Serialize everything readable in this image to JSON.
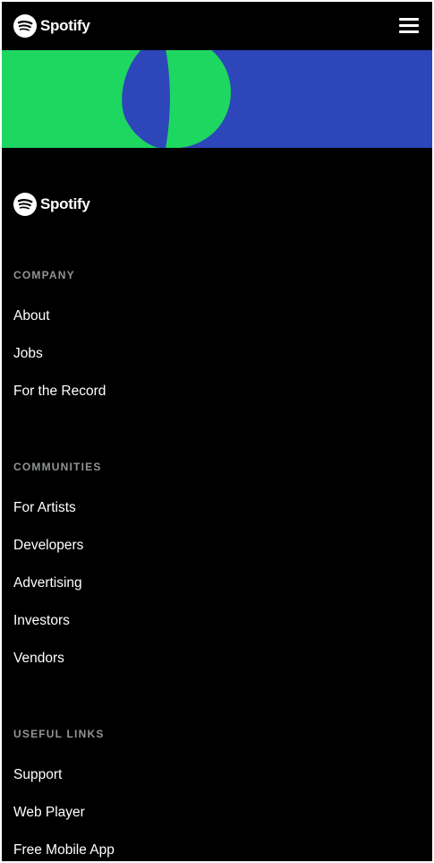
{
  "header": {
    "logo_text": "Spotify",
    "logo_icon": "spotify-logo-icon",
    "menu_icon": "hamburger-menu-icon"
  },
  "banner": {
    "colors": {
      "green": "#1ed760",
      "blue": "#2d46b9"
    }
  },
  "footer": {
    "logo_text": "Spotify",
    "sections": [
      {
        "heading": "COMPANY",
        "links": [
          "About",
          "Jobs",
          "For the Record"
        ]
      },
      {
        "heading": "COMMUNITIES",
        "links": [
          "For Artists",
          "Developers",
          "Advertising",
          "Investors",
          "Vendors"
        ]
      },
      {
        "heading": "USEFUL LINKS",
        "links": [
          "Support",
          "Web Player",
          "Free Mobile App"
        ]
      }
    ]
  },
  "colors": {
    "background": "#000000",
    "text": "#ffffff",
    "heading": "#919496"
  }
}
